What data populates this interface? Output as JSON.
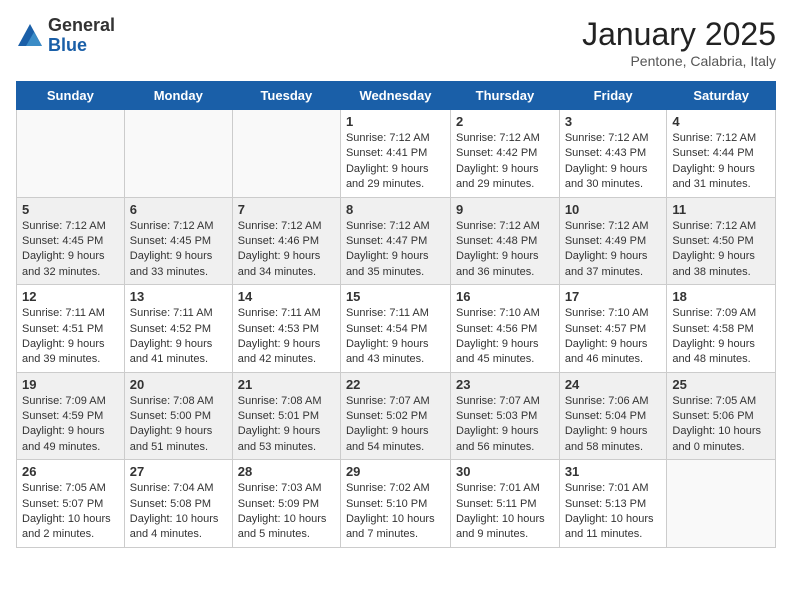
{
  "logo": {
    "general": "General",
    "blue": "Blue"
  },
  "title": "January 2025",
  "location": "Pentone, Calabria, Italy",
  "weekdays": [
    "Sunday",
    "Monday",
    "Tuesday",
    "Wednesday",
    "Thursday",
    "Friday",
    "Saturday"
  ],
  "weeks": [
    [
      {
        "day": "",
        "info": ""
      },
      {
        "day": "",
        "info": ""
      },
      {
        "day": "",
        "info": ""
      },
      {
        "day": "1",
        "info": "Sunrise: 7:12 AM\nSunset: 4:41 PM\nDaylight: 9 hours and 29 minutes."
      },
      {
        "day": "2",
        "info": "Sunrise: 7:12 AM\nSunset: 4:42 PM\nDaylight: 9 hours and 29 minutes."
      },
      {
        "day": "3",
        "info": "Sunrise: 7:12 AM\nSunset: 4:43 PM\nDaylight: 9 hours and 30 minutes."
      },
      {
        "day": "4",
        "info": "Sunrise: 7:12 AM\nSunset: 4:44 PM\nDaylight: 9 hours and 31 minutes."
      }
    ],
    [
      {
        "day": "5",
        "info": "Sunrise: 7:12 AM\nSunset: 4:45 PM\nDaylight: 9 hours and 32 minutes."
      },
      {
        "day": "6",
        "info": "Sunrise: 7:12 AM\nSunset: 4:45 PM\nDaylight: 9 hours and 33 minutes."
      },
      {
        "day": "7",
        "info": "Sunrise: 7:12 AM\nSunset: 4:46 PM\nDaylight: 9 hours and 34 minutes."
      },
      {
        "day": "8",
        "info": "Sunrise: 7:12 AM\nSunset: 4:47 PM\nDaylight: 9 hours and 35 minutes."
      },
      {
        "day": "9",
        "info": "Sunrise: 7:12 AM\nSunset: 4:48 PM\nDaylight: 9 hours and 36 minutes."
      },
      {
        "day": "10",
        "info": "Sunrise: 7:12 AM\nSunset: 4:49 PM\nDaylight: 9 hours and 37 minutes."
      },
      {
        "day": "11",
        "info": "Sunrise: 7:12 AM\nSunset: 4:50 PM\nDaylight: 9 hours and 38 minutes."
      }
    ],
    [
      {
        "day": "12",
        "info": "Sunrise: 7:11 AM\nSunset: 4:51 PM\nDaylight: 9 hours and 39 minutes."
      },
      {
        "day": "13",
        "info": "Sunrise: 7:11 AM\nSunset: 4:52 PM\nDaylight: 9 hours and 41 minutes."
      },
      {
        "day": "14",
        "info": "Sunrise: 7:11 AM\nSunset: 4:53 PM\nDaylight: 9 hours and 42 minutes."
      },
      {
        "day": "15",
        "info": "Sunrise: 7:11 AM\nSunset: 4:54 PM\nDaylight: 9 hours and 43 minutes."
      },
      {
        "day": "16",
        "info": "Sunrise: 7:10 AM\nSunset: 4:56 PM\nDaylight: 9 hours and 45 minutes."
      },
      {
        "day": "17",
        "info": "Sunrise: 7:10 AM\nSunset: 4:57 PM\nDaylight: 9 hours and 46 minutes."
      },
      {
        "day": "18",
        "info": "Sunrise: 7:09 AM\nSunset: 4:58 PM\nDaylight: 9 hours and 48 minutes."
      }
    ],
    [
      {
        "day": "19",
        "info": "Sunrise: 7:09 AM\nSunset: 4:59 PM\nDaylight: 9 hours and 49 minutes."
      },
      {
        "day": "20",
        "info": "Sunrise: 7:08 AM\nSunset: 5:00 PM\nDaylight: 9 hours and 51 minutes."
      },
      {
        "day": "21",
        "info": "Sunrise: 7:08 AM\nSunset: 5:01 PM\nDaylight: 9 hours and 53 minutes."
      },
      {
        "day": "22",
        "info": "Sunrise: 7:07 AM\nSunset: 5:02 PM\nDaylight: 9 hours and 54 minutes."
      },
      {
        "day": "23",
        "info": "Sunrise: 7:07 AM\nSunset: 5:03 PM\nDaylight: 9 hours and 56 minutes."
      },
      {
        "day": "24",
        "info": "Sunrise: 7:06 AM\nSunset: 5:04 PM\nDaylight: 9 hours and 58 minutes."
      },
      {
        "day": "25",
        "info": "Sunrise: 7:05 AM\nSunset: 5:06 PM\nDaylight: 10 hours and 0 minutes."
      }
    ],
    [
      {
        "day": "26",
        "info": "Sunrise: 7:05 AM\nSunset: 5:07 PM\nDaylight: 10 hours and 2 minutes."
      },
      {
        "day": "27",
        "info": "Sunrise: 7:04 AM\nSunset: 5:08 PM\nDaylight: 10 hours and 4 minutes."
      },
      {
        "day": "28",
        "info": "Sunrise: 7:03 AM\nSunset: 5:09 PM\nDaylight: 10 hours and 5 minutes."
      },
      {
        "day": "29",
        "info": "Sunrise: 7:02 AM\nSunset: 5:10 PM\nDaylight: 10 hours and 7 minutes."
      },
      {
        "day": "30",
        "info": "Sunrise: 7:01 AM\nSunset: 5:11 PM\nDaylight: 10 hours and 9 minutes."
      },
      {
        "day": "31",
        "info": "Sunrise: 7:01 AM\nSunset: 5:13 PM\nDaylight: 10 hours and 11 minutes."
      },
      {
        "day": "",
        "info": ""
      }
    ]
  ]
}
